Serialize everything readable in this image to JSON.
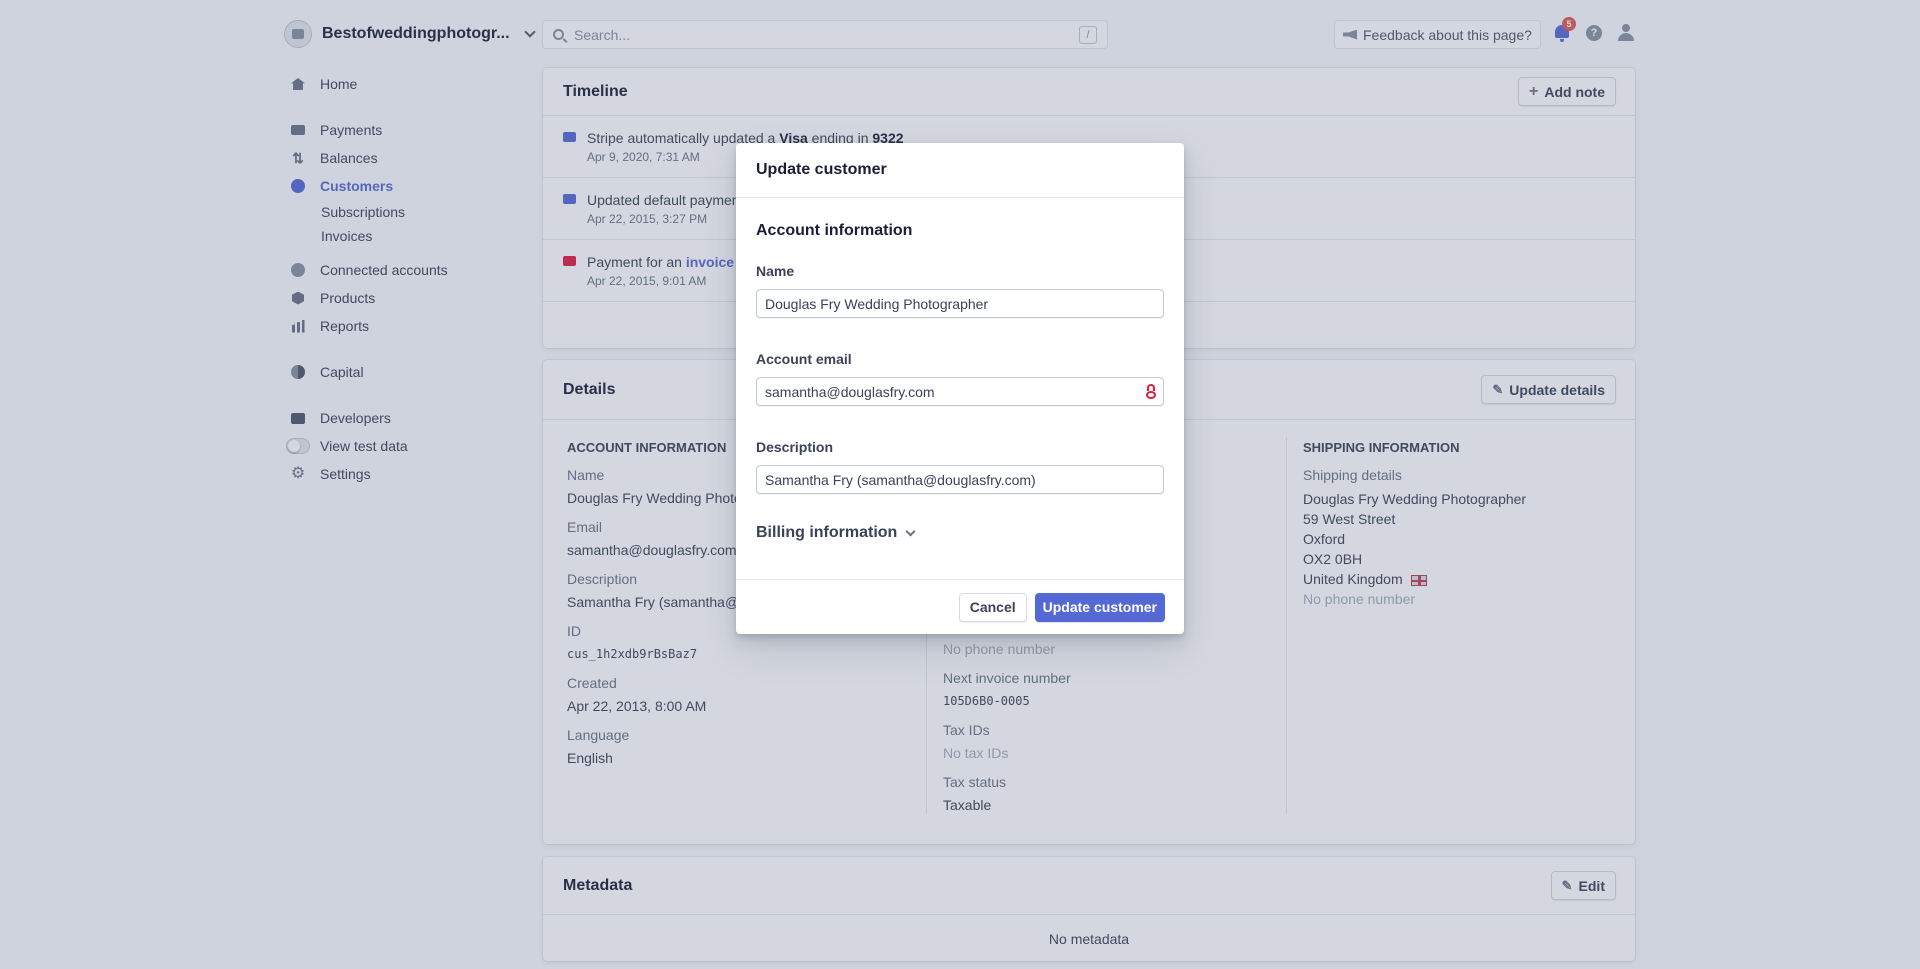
{
  "topbar": {
    "account_name": "Bestofweddingphotogr...",
    "search_placeholder": "Search...",
    "search_shortcut": "/",
    "feedback_label": "Feedback about this page?",
    "notification_count": "5",
    "help_glyph": "?"
  },
  "sidebar": {
    "home": "Home",
    "payments": "Payments",
    "balances": "Balances",
    "customers": "Customers",
    "subscriptions": "Subscriptions",
    "invoices": "Invoices",
    "connected_accounts": "Connected accounts",
    "products": "Products",
    "reports": "Reports",
    "capital": "Capital",
    "developers": "Developers",
    "view_test_data": "View test data",
    "settings": "Settings"
  },
  "timeline": {
    "title": "Timeline",
    "add_note": "Add note",
    "items": [
      {
        "prefix": "Stripe automatically updated a ",
        "bold1": "Visa",
        "mid": " ending in ",
        "bold2": "9322",
        "date": "Apr 9, 2020, 7:31 AM"
      },
      {
        "text": "Updated default paymen",
        "date": "Apr 22, 2015, 3:27 PM"
      },
      {
        "prefix": "Payment for an ",
        "link": "invoice f",
        "date": "Apr 22, 2015, 9:01 AM"
      }
    ]
  },
  "details": {
    "title": "Details",
    "update_button": "Update details",
    "account_info_header": "ACCOUNT INFORMATION",
    "name_label": "Name",
    "name_value": "Douglas Fry Wedding Photog",
    "email_label": "Email",
    "email_value": "samantha@douglasfry.com",
    "description_label": "Description",
    "description_value": "Samantha Fry (samantha@d",
    "id_label": "ID",
    "id_value": "cus_1h2xdb9rBsBaz7",
    "created_label": "Created",
    "created_value": "Apr 22, 2013, 8:00 AM",
    "language_label": "Language",
    "language_value": "English",
    "no_phone_mid": "No phone number",
    "next_invoice_label": "Next invoice number",
    "next_invoice_value": "105D6B0-0005",
    "tax_ids_label": "Tax IDs",
    "tax_ids_value": "No tax IDs",
    "tax_status_label": "Tax status",
    "tax_status_value": "Taxable",
    "shipping_header": "SHIPPING INFORMATION",
    "shipping_label": "Shipping details",
    "shipping_name": "Douglas Fry Wedding Photographer",
    "shipping_street": "59 West Street",
    "shipping_city": "Oxford",
    "shipping_postcode": "OX2 0BH",
    "shipping_country": "United Kingdom",
    "shipping_phone": "No phone number"
  },
  "metadata": {
    "title": "Metadata",
    "edit": "Edit",
    "empty": "No metadata"
  },
  "modal": {
    "title": "Update customer",
    "section": "Account information",
    "name_label": "Name",
    "name_value": "Douglas Fry Wedding Photographer",
    "email_label": "Account email",
    "email_value": "samantha@douglasfry.com",
    "description_label": "Description",
    "description_value": "Samantha Fry (samantha@douglasfry.com)",
    "billing": "Billing information",
    "cancel": "Cancel",
    "submit": "Update customer"
  },
  "colors": {
    "accent": "#5469d4",
    "badge": "#e25950",
    "lock": "#df1b41"
  }
}
